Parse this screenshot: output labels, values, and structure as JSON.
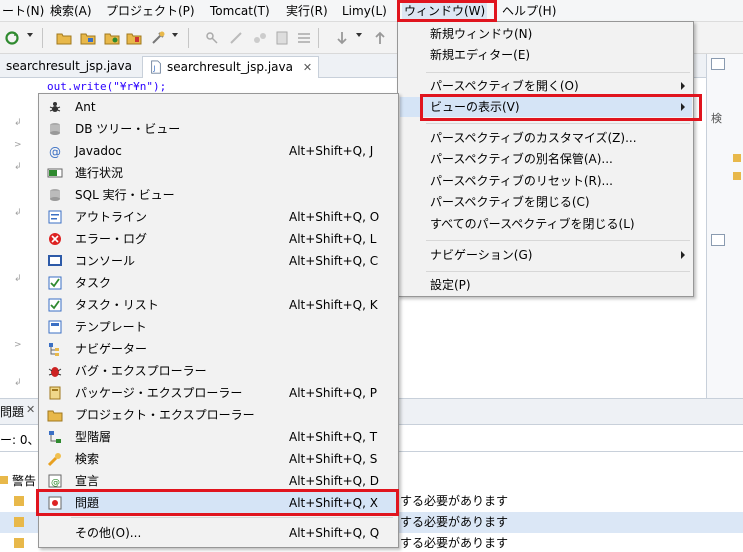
{
  "menubar": {
    "items": [
      {
        "label": "ート(N)"
      },
      {
        "label": "検索(A)"
      },
      {
        "label": "プロジェクト(P)"
      },
      {
        "label": "Tomcat(T)"
      },
      {
        "label": "実行(R)"
      },
      {
        "label": "Limy(L)"
      },
      {
        "label": "ウィンドウ(W)"
      },
      {
        "label": "ヘルプ(H)"
      }
    ]
  },
  "editor": {
    "tabs": [
      {
        "label": "searchresult_jsp.java"
      },
      {
        "label": "searchresult_jsp.java"
      }
    ],
    "code_line": "out.write(\"¥r¥n\");",
    "right_panel_text": "検"
  },
  "window_menu": {
    "items": [
      {
        "label": "新規ウィンドウ(N)"
      },
      {
        "label": "新規エディター(E)"
      },
      {
        "label": "パースペクティブを開く(O)"
      },
      {
        "label": "ビューの表示(V)"
      },
      {
        "label": "パースペクティブのカスタマイズ(Z)..."
      },
      {
        "label": "パースペクティブの別名保管(A)..."
      },
      {
        "label": "パースペクティブのリセット(R)..."
      },
      {
        "label": "パースペクティブを閉じる(C)"
      },
      {
        "label": "すべてのパースペクティブを閉じる(L)"
      },
      {
        "label": "ナビゲーション(G)"
      },
      {
        "label": "設定(P)"
      }
    ]
  },
  "view_menu": {
    "items": [
      {
        "label": "Ant",
        "shortcut": "",
        "icon": "ant-icon"
      },
      {
        "label": "DB ツリー・ビュー",
        "shortcut": "",
        "icon": "database-icon"
      },
      {
        "label": "Javadoc",
        "shortcut": "Alt+Shift+Q, J",
        "icon": "javadoc-icon"
      },
      {
        "label": "進行状況",
        "shortcut": "",
        "icon": "progress-icon"
      },
      {
        "label": "SQL 実行・ビュー",
        "shortcut": "",
        "icon": "sql-icon"
      },
      {
        "label": "アウトライン",
        "shortcut": "Alt+Shift+Q, O",
        "icon": "outline-icon"
      },
      {
        "label": "エラー・ログ",
        "shortcut": "Alt+Shift+Q, L",
        "icon": "error-log-icon"
      },
      {
        "label": "コンソール",
        "shortcut": "Alt+Shift+Q, C",
        "icon": "console-icon"
      },
      {
        "label": "タスク",
        "shortcut": "",
        "icon": "task-icon"
      },
      {
        "label": "タスク・リスト",
        "shortcut": "Alt+Shift+Q, K",
        "icon": "task-list-icon"
      },
      {
        "label": "テンプレート",
        "shortcut": "",
        "icon": "template-icon"
      },
      {
        "label": "ナビゲーター",
        "shortcut": "",
        "icon": "navigator-icon"
      },
      {
        "label": "バグ・エクスプローラー",
        "shortcut": "",
        "icon": "bug-icon"
      },
      {
        "label": "パッケージ・エクスプローラー",
        "shortcut": "Alt+Shift+Q, P",
        "icon": "package-explorer-icon"
      },
      {
        "label": "プロジェクト・エクスプローラー",
        "shortcut": "",
        "icon": "project-explorer-icon"
      },
      {
        "label": "型階層",
        "shortcut": "Alt+Shift+Q, T",
        "icon": "type-hierarchy-icon"
      },
      {
        "label": "検索",
        "shortcut": "Alt+Shift+Q, S",
        "icon": "search-icon"
      },
      {
        "label": "宣言",
        "shortcut": "Alt+Shift+Q, D",
        "icon": "declaration-icon"
      },
      {
        "label": "問題",
        "shortcut": "Alt+Shift+Q, X",
        "icon": "problems-icon"
      },
      {
        "label": "その他(O)...",
        "shortcut": "Alt+Shift+Q, Q",
        "icon": ""
      }
    ]
  },
  "bottom_view": {
    "tab_label": "問題",
    "summary": "ー: 0、",
    "group_label": "警告",
    "rows": [
      {
        "text": "する必要があります"
      },
      {
        "text": "する必要があります"
      },
      {
        "text": "する必要があります"
      }
    ]
  },
  "colors": {
    "highlight": "#e0141e",
    "menu_bg": "#f2f2f2",
    "editor_string": "#2a00ff"
  }
}
